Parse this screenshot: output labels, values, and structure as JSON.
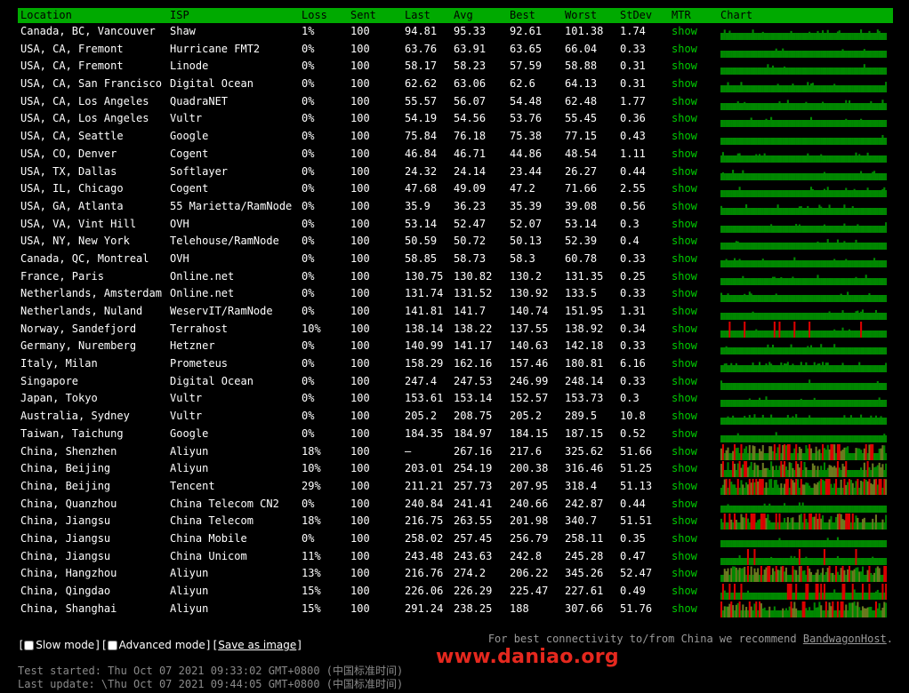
{
  "columns": {
    "location": "Location",
    "isp": "ISP",
    "loss": "Loss",
    "sent": "Sent",
    "last": "Last",
    "avg": "Avg",
    "best": "Best",
    "worst": "Worst",
    "stdev": "StDev",
    "mtr": "MTR",
    "chart": "Chart"
  },
  "rows": [
    {
      "location": "Canada, BC, Vancouver",
      "isp": "Shaw",
      "loss": "1%",
      "sent": "100",
      "last": "94.81",
      "avg": "95.33",
      "best": "92.61",
      "worst": "101.38",
      "stdev": "1.74",
      "mtr": "show",
      "noise": 0.1,
      "drops": 0.01
    },
    {
      "location": "USA, CA, Fremont",
      "isp": "Hurricane FMT2",
      "loss": "0%",
      "sent": "100",
      "last": "63.76",
      "avg": "63.91",
      "best": "63.65",
      "worst": "66.04",
      "stdev": "0.33",
      "mtr": "show",
      "noise": 0.05,
      "drops": 0
    },
    {
      "location": "USA, CA, Fremont",
      "isp": "Linode",
      "loss": "0%",
      "sent": "100",
      "last": "58.17",
      "avg": "58.23",
      "best": "57.59",
      "worst": "58.88",
      "stdev": "0.31",
      "mtr": "show",
      "noise": 0.05,
      "drops": 0
    },
    {
      "location": "USA, CA, San Francisco",
      "isp": "Digital Ocean",
      "loss": "0%",
      "sent": "100",
      "last": "62.62",
      "avg": "63.06",
      "best": "62.6",
      "worst": "64.13",
      "stdev": "0.31",
      "mtr": "show",
      "noise": 0.05,
      "drops": 0
    },
    {
      "location": "USA, CA, Los Angeles",
      "isp": "QuadraNET",
      "loss": "0%",
      "sent": "100",
      "last": "55.57",
      "avg": "56.07",
      "best": "54.48",
      "worst": "62.48",
      "stdev": "1.77",
      "mtr": "show",
      "noise": 0.1,
      "drops": 0
    },
    {
      "location": "USA, CA, Los Angeles",
      "isp": "Vultr",
      "loss": "0%",
      "sent": "100",
      "last": "54.19",
      "avg": "54.56",
      "best": "53.76",
      "worst": "55.45",
      "stdev": "0.36",
      "mtr": "show",
      "noise": 0.05,
      "drops": 0
    },
    {
      "location": "USA, CA, Seattle",
      "isp": "Google",
      "loss": "0%",
      "sent": "100",
      "last": "75.84",
      "avg": "76.18",
      "best": "75.38",
      "worst": "77.15",
      "stdev": "0.43",
      "mtr": "show",
      "noise": 0.05,
      "drops": 0
    },
    {
      "location": "USA, CO, Denver",
      "isp": "Cogent",
      "loss": "0%",
      "sent": "100",
      "last": "46.84",
      "avg": "46.71",
      "best": "44.86",
      "worst": "48.54",
      "stdev": "1.11",
      "mtr": "show",
      "noise": 0.1,
      "drops": 0
    },
    {
      "location": "USA, TX, Dallas",
      "isp": "Softlayer",
      "loss": "0%",
      "sent": "100",
      "last": "24.32",
      "avg": "24.14",
      "best": "23.44",
      "worst": "26.27",
      "stdev": "0.44",
      "mtr": "show",
      "noise": 0.05,
      "drops": 0
    },
    {
      "location": "USA, IL, Chicago",
      "isp": "Cogent",
      "loss": "0%",
      "sent": "100",
      "last": "47.68",
      "avg": "49.09",
      "best": "47.2",
      "worst": "71.66",
      "stdev": "2.55",
      "mtr": "show",
      "noise": 0.1,
      "drops": 0
    },
    {
      "location": "USA, GA, Atlanta",
      "isp": "55 Marietta/RamNode",
      "loss": "0%",
      "sent": "100",
      "last": "35.9",
      "avg": "36.23",
      "best": "35.39",
      "worst": "39.08",
      "stdev": "0.56",
      "mtr": "show",
      "noise": 0.08,
      "drops": 0
    },
    {
      "location": "USA, VA, Vint Hill",
      "isp": "OVH",
      "loss": "0%",
      "sent": "100",
      "last": "53.14",
      "avg": "52.47",
      "best": "52.07",
      "worst": "53.14",
      "stdev": "0.3",
      "mtr": "show",
      "noise": 0.05,
      "drops": 0
    },
    {
      "location": "USA, NY, New York",
      "isp": "Telehouse/RamNode",
      "loss": "0%",
      "sent": "100",
      "last": "50.59",
      "avg": "50.72",
      "best": "50.13",
      "worst": "52.39",
      "stdev": "0.4",
      "mtr": "show",
      "noise": 0.05,
      "drops": 0
    },
    {
      "location": "Canada, QC, Montreal",
      "isp": "OVH",
      "loss": "0%",
      "sent": "100",
      "last": "58.85",
      "avg": "58.73",
      "best": "58.3",
      "worst": "60.78",
      "stdev": "0.33",
      "mtr": "show",
      "noise": 0.05,
      "drops": 0
    },
    {
      "location": "France, Paris",
      "isp": "Online.net",
      "loss": "0%",
      "sent": "100",
      "last": "130.75",
      "avg": "130.82",
      "best": "130.2",
      "worst": "131.35",
      "stdev": "0.25",
      "mtr": "show",
      "noise": 0.05,
      "drops": 0
    },
    {
      "location": "Netherlands, Amsterdam",
      "isp": "Online.net",
      "loss": "0%",
      "sent": "100",
      "last": "131.74",
      "avg": "131.52",
      "best": "130.92",
      "worst": "133.5",
      "stdev": "0.33",
      "mtr": "show",
      "noise": 0.05,
      "drops": 0
    },
    {
      "location": "Netherlands, Nuland",
      "isp": "WeservIT/RamNode",
      "loss": "0%",
      "sent": "100",
      "last": "141.81",
      "avg": "141.7",
      "best": "140.74",
      "worst": "151.95",
      "stdev": "1.31",
      "mtr": "show",
      "noise": 0.1,
      "drops": 0
    },
    {
      "location": "Norway, Sandefjord",
      "isp": "Terrahost",
      "loss": "10%",
      "sent": "100",
      "last": "138.14",
      "avg": "138.22",
      "best": "137.55",
      "worst": "138.92",
      "stdev": "0.34",
      "mtr": "show",
      "noise": 0.05,
      "drops": 0.1
    },
    {
      "location": "Germany, Nuremberg",
      "isp": "Hetzner",
      "loss": "0%",
      "sent": "100",
      "last": "140.99",
      "avg": "141.17",
      "best": "140.63",
      "worst": "142.18",
      "stdev": "0.33",
      "mtr": "show",
      "noise": 0.05,
      "drops": 0
    },
    {
      "location": "Italy, Milan",
      "isp": "Prometeus",
      "loss": "0%",
      "sent": "100",
      "last": "158.29",
      "avg": "162.16",
      "best": "157.46",
      "worst": "180.81",
      "stdev": "6.16",
      "mtr": "show",
      "noise": 0.15,
      "drops": 0
    },
    {
      "location": "Singapore",
      "isp": "Digital Ocean",
      "loss": "0%",
      "sent": "100",
      "last": "247.4",
      "avg": "247.53",
      "best": "246.99",
      "worst": "248.14",
      "stdev": "0.33",
      "mtr": "show",
      "noise": 0.05,
      "drops": 0
    },
    {
      "location": "Japan, Tokyo",
      "isp": "Vultr",
      "loss": "0%",
      "sent": "100",
      "last": "153.61",
      "avg": "153.14",
      "best": "152.57",
      "worst": "153.73",
      "stdev": "0.3",
      "mtr": "show",
      "noise": 0.05,
      "drops": 0
    },
    {
      "location": "Australia, Sydney",
      "isp": "Vultr",
      "loss": "0%",
      "sent": "100",
      "last": "205.2",
      "avg": "208.75",
      "best": "205.2",
      "worst": "289.5",
      "stdev": "10.8",
      "mtr": "show",
      "noise": 0.2,
      "drops": 0
    },
    {
      "location": "Taiwan, Taichung",
      "isp": "Google",
      "loss": "0%",
      "sent": "100",
      "last": "184.35",
      "avg": "184.97",
      "best": "184.15",
      "worst": "187.15",
      "stdev": "0.52",
      "mtr": "show",
      "noise": 0.05,
      "drops": 0
    },
    {
      "location": "China, Shenzhen",
      "isp": "Aliyun",
      "loss": "18%",
      "sent": "100",
      "last": "–",
      "avg": "267.16",
      "best": "217.6",
      "worst": "325.62",
      "stdev": "51.66",
      "mtr": "show",
      "noise": 0.6,
      "drops": 0.18
    },
    {
      "location": "China, Beijing",
      "isp": "Aliyun",
      "loss": "10%",
      "sent": "100",
      "last": "203.01",
      "avg": "254.19",
      "best": "200.38",
      "worst": "316.46",
      "stdev": "51.25",
      "mtr": "show",
      "noise": 0.6,
      "drops": 0.1
    },
    {
      "location": "China, Beijing",
      "isp": "Tencent",
      "loss": "29%",
      "sent": "100",
      "last": "211.21",
      "avg": "257.73",
      "best": "207.95",
      "worst": "318.4",
      "stdev": "51.13",
      "mtr": "show",
      "noise": 0.6,
      "drops": 0.29
    },
    {
      "location": "China, Quanzhou",
      "isp": "China Telecom CN2",
      "loss": "0%",
      "sent": "100",
      "last": "240.84",
      "avg": "241.41",
      "best": "240.66",
      "worst": "242.87",
      "stdev": "0.44",
      "mtr": "show",
      "noise": 0.05,
      "drops": 0
    },
    {
      "location": "China, Jiangsu",
      "isp": "China Telecom",
      "loss": "18%",
      "sent": "100",
      "last": "216.75",
      "avg": "263.55",
      "best": "201.98",
      "worst": "340.7",
      "stdev": "51.51",
      "mtr": "show",
      "noise": 0.6,
      "drops": 0.18
    },
    {
      "location": "China, Jiangsu",
      "isp": "China Mobile",
      "loss": "0%",
      "sent": "100",
      "last": "258.02",
      "avg": "257.45",
      "best": "256.79",
      "worst": "258.11",
      "stdev": "0.35",
      "mtr": "show",
      "noise": 0.05,
      "drops": 0
    },
    {
      "location": "China, Jiangsu",
      "isp": "China Unicom",
      "loss": "11%",
      "sent": "100",
      "last": "243.48",
      "avg": "243.63",
      "best": "242.8",
      "worst": "245.28",
      "stdev": "0.47",
      "mtr": "show",
      "noise": 0.05,
      "drops": 0.11
    },
    {
      "location": "China, Hangzhou",
      "isp": "Aliyun",
      "loss": "13%",
      "sent": "100",
      "last": "216.76",
      "avg": "274.2",
      "best": "206.22",
      "worst": "345.26",
      "stdev": "52.47",
      "mtr": "show",
      "noise": 0.6,
      "drops": 0.13
    },
    {
      "location": "China, Qingdao",
      "isp": "Aliyun",
      "loss": "15%",
      "sent": "100",
      "last": "226.06",
      "avg": "226.29",
      "best": "225.47",
      "worst": "227.61",
      "stdev": "0.49",
      "mtr": "show",
      "noise": 0.05,
      "drops": 0.15
    },
    {
      "location": "China, Shanghai",
      "isp": "Aliyun",
      "loss": "15%",
      "sent": "100",
      "last": "291.24",
      "avg": "238.25",
      "best": "188",
      "worst": "307.66",
      "stdev": "51.76",
      "mtr": "show",
      "noise": 0.6,
      "drops": 0.15
    }
  ],
  "footer": {
    "bracket_open": "[",
    "slow_mode_label": "Slow mode",
    "separator": "][",
    "advanced_mode_label": "Advanced mode",
    "save_image_label": "Save as image",
    "bracket_close": "]",
    "recommend_text": "For best connectivity to/from China we recommend ",
    "recommend_link": "BandwagonHost",
    "recommend_end": "."
  },
  "watermark": "www.daniao.org",
  "status": {
    "started": "Test started: Thu Oct 07 2021 09:33:02 GMT+0800 (中国标准时间)",
    "updated": "Last update: \\Thu Oct 07 2021 09:44:05 GMT+0800 (中国标准时间)"
  },
  "colors": {
    "header_bg": "#00aa00",
    "chart_ok": "#008800",
    "chart_jitter": "#6b7a1f",
    "chart_drop": "#dd0000",
    "mtr_link": "#00cc00"
  }
}
